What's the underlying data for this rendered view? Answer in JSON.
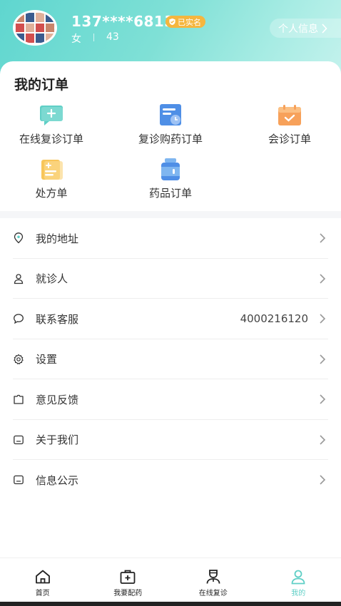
{
  "profile": {
    "phone": "137****6813",
    "verified_label": "已实名",
    "gender": "女",
    "age": "43",
    "info_button": "个人信息"
  },
  "orders": {
    "title": "我的订单",
    "items": [
      {
        "label": "在线复诊订单",
        "icon": "chat-plus-icon"
      },
      {
        "label": "复诊购药订单",
        "icon": "document-clock-icon"
      },
      {
        "label": "会诊订单",
        "icon": "calendar-check-icon"
      },
      {
        "label": "处方单",
        "icon": "prescription-icon"
      },
      {
        "label": "药品订单",
        "icon": "medicine-bottle-icon"
      }
    ]
  },
  "menu": {
    "items": [
      {
        "label": "我的地址",
        "icon": "location-icon"
      },
      {
        "label": "就诊人",
        "icon": "person-icon"
      },
      {
        "label": "联系客服",
        "icon": "chat-bubble-icon",
        "value": "4000216120"
      },
      {
        "label": "设置",
        "icon": "gear-icon"
      },
      {
        "label": "意见反馈",
        "icon": "feedback-icon"
      },
      {
        "label": "关于我们",
        "icon": "info-box-icon"
      },
      {
        "label": "信息公示",
        "icon": "notice-icon"
      }
    ]
  },
  "tabbar": {
    "items": [
      {
        "label": "首页",
        "icon": "home-icon"
      },
      {
        "label": "我要配药",
        "icon": "medical-kit-icon"
      },
      {
        "label": "在线复诊",
        "icon": "doctor-icon"
      },
      {
        "label": "我的",
        "icon": "user-icon"
      }
    ],
    "active_index": 3
  },
  "colors": {
    "accent": "#5fcfc6",
    "verified_badge": "#f5b63e"
  }
}
